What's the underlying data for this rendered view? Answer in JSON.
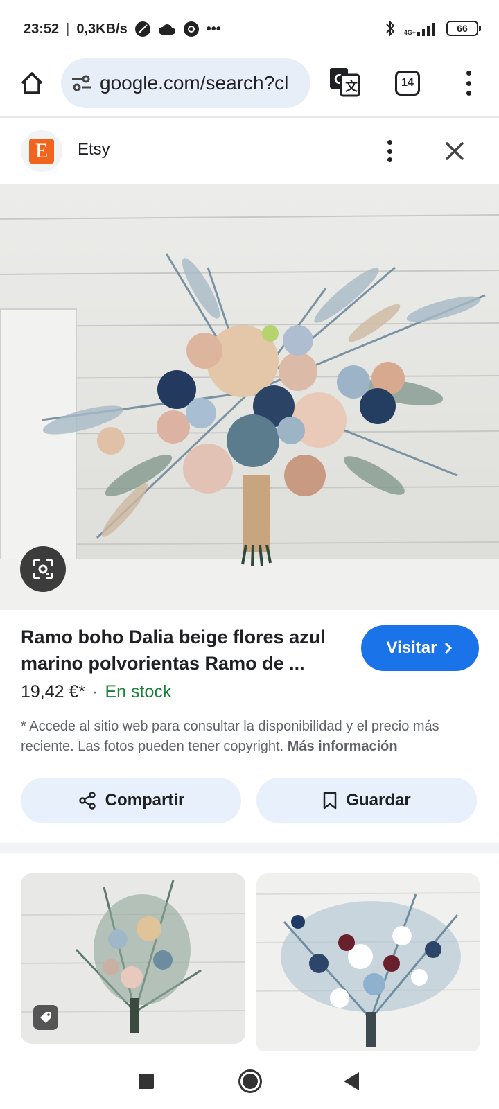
{
  "status_bar": {
    "time": "23:52",
    "speed": "0,3KB/s",
    "more": "•••",
    "network": "4G+",
    "battery": "66"
  },
  "browser": {
    "url": "google.com/search?cl",
    "tab_count": "14"
  },
  "source": {
    "logo_letter": "E",
    "name": "Etsy"
  },
  "product": {
    "title": "Ramo boho Dalia beige flores azul marino polvorientas Ramo de ...",
    "visit_label": "Visitar",
    "price": "19,42 €*",
    "separator": "·",
    "stock": "En stock",
    "disclaimer": "* Accede al sitio web para consultar la disponibilidad y el precio más reciente. Las fotos pueden tener copyright.",
    "more_info": "Más información"
  },
  "actions": {
    "share_label": "Compartir",
    "save_label": "Guardar"
  },
  "colors": {
    "accent": "#1a73e8",
    "stock_green": "#188038",
    "etsy_orange": "#f1641e"
  }
}
